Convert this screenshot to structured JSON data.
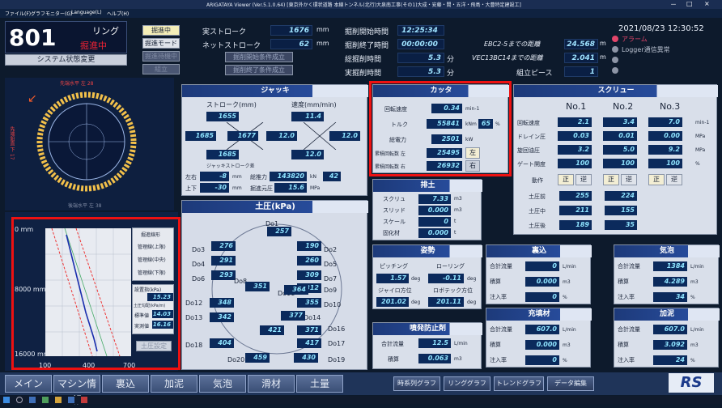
{
  "window": {
    "title": "ARIGATAYA Viewer (Ver.5.1.0.64) [東京外かく環状道路 本線トンネル(北行)大泉南工事(その1)大成・安藤・間・五洋・飛島・大豊特定建設工]",
    "menus": [
      "ファイル(F)",
      "グラフモニター(G)",
      "Language(L)",
      "ヘルプ(H)"
    ],
    "controls": [
      "－",
      "□",
      "×"
    ]
  },
  "top": {
    "ring_label": "リング",
    "ring_value": "801",
    "status_red": "掘進中",
    "sys_button": "システム状態変更",
    "btn_mining": "掘進中",
    "btn_mode": "掘進モード",
    "btn_dim1": "掘進待機中",
    "btn_dim2": "組立",
    "actual_stroke_label": "実ストローク",
    "actual_stroke": "1676",
    "net_stroke_label": "ネットストローク",
    "net_stroke": "62",
    "mm": "mm",
    "cond_start": "掘削開始条件成立",
    "cond_end": "掘削終了条件成立",
    "start_time_label": "掘削開始時間",
    "start_time": "12:25:34",
    "end_time_label": "掘削終了時間",
    "end_time": "00:00:00",
    "total_time_label": "総掘削時間",
    "total_time": "5.3",
    "actual_time_label": "実掘削時間",
    "actual_time": "5.3",
    "min_unit": "分",
    "ebc_label": "EBC2-5までの距離",
    "ebc_value": "24.568",
    "vec_label": "VEC13BC14までの距離",
    "vec_value": "2.041",
    "m": "m",
    "piece_label": "組立ピース",
    "piece_value": "1",
    "datetime": "2021/08/23 12:30:52",
    "alarm": "アラーム",
    "logger": "Logger通信異常"
  },
  "cutter": {
    "title": "カッタ",
    "speed_l": "回転速度",
    "speed": "0.34",
    "speed_u": "min-1",
    "torque_l": "トルク",
    "torque": "55841",
    "torque_u": "kNm",
    "torque_pct": "65",
    "pct": "%",
    "power_l": "総電力",
    "power": "2501",
    "power_u": "kW",
    "left_l": "累積回転数 左",
    "left": "25495",
    "left_dir": "左",
    "right_l": "累積回転数 右",
    "right": "26932",
    "right_dir": "右"
  },
  "jack": {
    "title": "ジャッキ",
    "stroke_l": "ストローク(mm)",
    "speed_l": "速度(mm/min)",
    "s_top": "1655",
    "v_top": "11.4",
    "s_left": "1685",
    "s_right": "1677",
    "v_left": "12.0",
    "v_right": "12.0",
    "s_bot": "1685",
    "v_bot": "12.0",
    "diff_l": "ジャッキストローク差",
    "lr_l": "左右",
    "lr": "-8",
    "ud_l": "上下",
    "ud": "-30",
    "thrust_l": "総推力",
    "thrust": "143820",
    "thrust_u": "kN",
    "thrust_pct": "42",
    "dig_l": "掘進元圧",
    "dig": "15.6",
    "dig_u": "MPa",
    "mm": "mm"
  },
  "soil": {
    "title": "土圧(kPa)",
    "items": [
      {
        "n": "Do1",
        "v": "257"
      },
      {
        "n": "Do2",
        "v": "190"
      },
      {
        "n": "Do3",
        "v": "276"
      },
      {
        "n": "Do4",
        "v": "291"
      },
      {
        "n": "Do5",
        "v": "260"
      },
      {
        "n": "Do6",
        "v": "293"
      },
      {
        "n": "Do7",
        "v": "309"
      },
      {
        "n": "Do8",
        "v": "351"
      },
      {
        "n": "Do9",
        "v": "312"
      },
      {
        "n": "Do10",
        "v": "355"
      },
      {
        "n": "Do11",
        "v": "364"
      },
      {
        "n": "Do12",
        "v": "348"
      },
      {
        "n": "Do13",
        "v": "342"
      },
      {
        "n": "Do14",
        "v": "377"
      },
      {
        "n": "Do15",
        "v": "421"
      },
      {
        "n": "Do16",
        "v": "371"
      },
      {
        "n": "Do17",
        "v": "417"
      },
      {
        "n": "Do18",
        "v": "404"
      },
      {
        "n": "Do19",
        "v": "430"
      },
      {
        "n": "Do20",
        "v": "459"
      }
    ]
  },
  "haido": {
    "title": "排土",
    "screw_l": "スクリュ",
    "screw": "7.33",
    "screw_u": "m3",
    "slide_l": "スリッド",
    "slide": "0.000",
    "slide_u": "m3",
    "scale_l": "スケール",
    "scale": "0",
    "scale_u": "t",
    "solid_l": "固化材",
    "solid": "0.000",
    "solid_u": "t"
  },
  "attitude": {
    "title": "姿勢",
    "pitch_l": "ピッチング",
    "pitch": "1.57",
    "roll_l": "ローリング",
    "roll": "-0.11",
    "deg": "deg",
    "gyro_l": "ジャイロ方位",
    "gyro": "201.02",
    "robo_l": "ロボテック方位",
    "robo": "201.11"
  },
  "spray": {
    "title": "噴発防止剤",
    "flow_l": "合計流量",
    "flow": "12.5",
    "flow_u": "L/min",
    "total_l": "積算",
    "total": "0.063",
    "total_u": "m3"
  },
  "screw": {
    "title": "スクリュー",
    "cols": [
      "No.1",
      "No.2",
      "No.3"
    ],
    "rows": [
      {
        "l": "回転速度",
        "v": [
          "2.1",
          "3.4",
          "7.0"
        ],
        "u": "min-1"
      },
      {
        "l": "ドレイン圧",
        "v": [
          "0.03",
          "0.01",
          "0.00"
        ],
        "u": "MPa"
      },
      {
        "l": "旋回油圧",
        "v": [
          "3.2",
          "5.0",
          "9.2"
        ],
        "u": "MPa"
      },
      {
        "l": "ゲート開度",
        "v": [
          "100",
          "100",
          "100"
        ],
        "u": "%"
      }
    ],
    "action_l": "動作",
    "fwd": "正",
    "rev": "逆",
    "ep_front_l": "土圧前",
    "ep_front": [
      "255",
      "224"
    ],
    "ep_mid_l": "土圧中",
    "ep_mid": [
      "211",
      "155"
    ],
    "ep_back_l": "土圧後",
    "ep_back": [
      "189",
      "35"
    ]
  },
  "backfill": {
    "title": "裏込",
    "flow_l": "合計流量",
    "flow": "0",
    "flow_u": "L/min",
    "total_l": "積算",
    "total": "0.000",
    "total_u": "m3",
    "rate_l": "注入率",
    "rate": "0",
    "rate_u": "%"
  },
  "filler": {
    "title": "充填材",
    "flow_l": "合計流量",
    "flow": "607.0",
    "flow_u": "L/min",
    "total_l": "積算",
    "total": "0.000",
    "total_u": "m3",
    "rate_l": "注入率",
    "rate": "0",
    "rate_u": "%"
  },
  "foam": {
    "title": "気泡",
    "flow_l": "合計流量",
    "flow": "1384",
    "flow_u": "L/min",
    "total_l": "積算",
    "total": "4.289",
    "total_u": "m3",
    "rate_l": "注入率",
    "rate": "34",
    "rate_u": "%"
  },
  "mud": {
    "title": "加泥",
    "flow_l": "合計流量",
    "flow": "607.0",
    "flow_u": "L/min",
    "total_l": "積算",
    "total": "3.092",
    "total_u": "m3",
    "rate_l": "注入率",
    "rate": "24",
    "rate_u": "%"
  },
  "ringview": {
    "top_label": "先端水平 左 28",
    "bottom_label": "後端水平 左 38",
    "side_label": "先端鉛直 下 17"
  },
  "chart_data": {
    "type": "line",
    "y_labels": [
      "0 mm",
      "8000 mm",
      "16000 mm"
    ],
    "x_ticks": [
      "100",
      "400",
      "700"
    ],
    "legend": [
      "掘進線形",
      "管理線(上限)",
      "管理線(中央)",
      "管理線(下限)"
    ],
    "press_l": "設置指(kPa)",
    "press": "15.23",
    "kpa_l": "土圧勾配(kPa/m)",
    "std_l": "標準値",
    "std": "14.03",
    "real_l": "実測値",
    "real": "16.16",
    "btn": "土圧設定"
  },
  "bottom": {
    "tabs": [
      "メイン",
      "マシン情報",
      "裏込",
      "加泥",
      "気泡",
      "滑材",
      "土量"
    ],
    "tabs2": [
      "時系列グラフ",
      "リンググラフ",
      "トレンドグラフ",
      "データ編集"
    ],
    "logo": "RS"
  }
}
